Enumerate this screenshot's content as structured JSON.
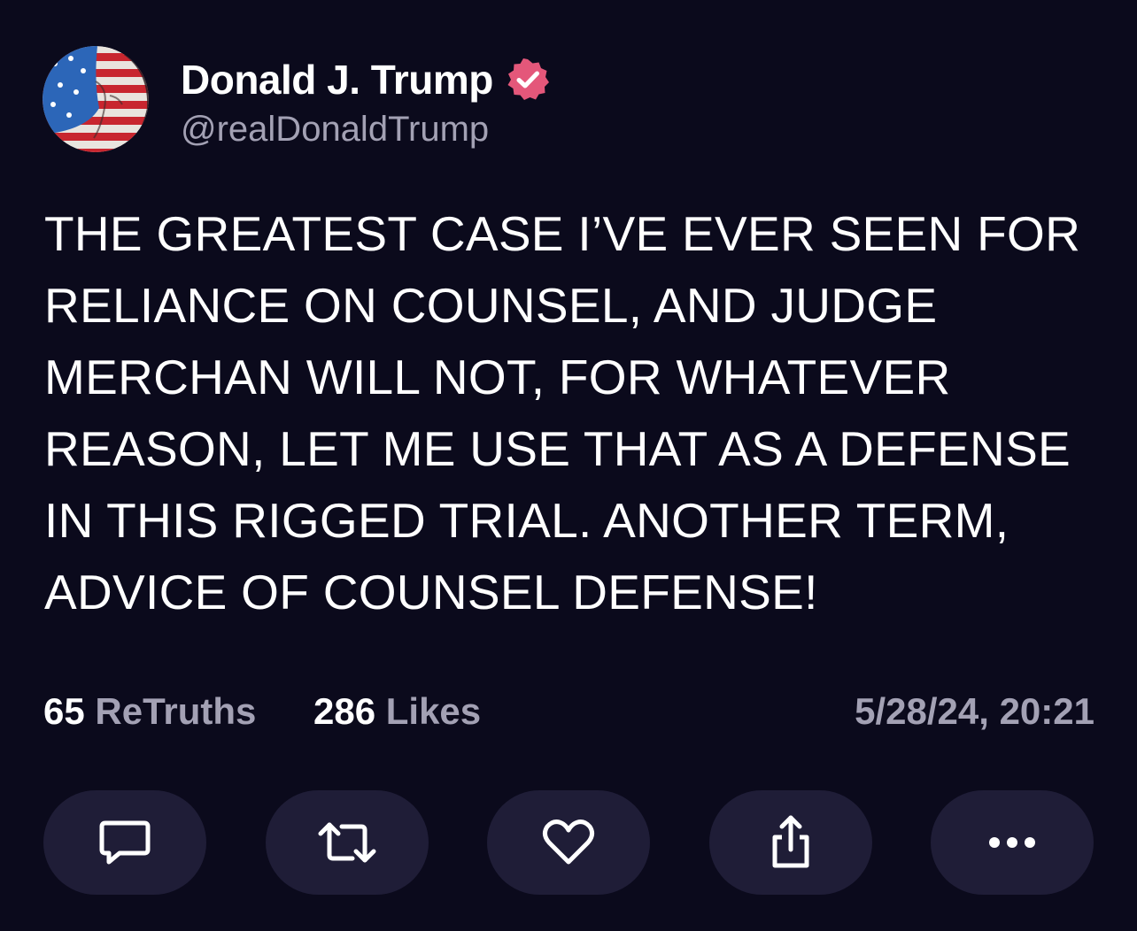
{
  "post": {
    "author": {
      "display_name": "Donald J. Trump",
      "handle": "@realDonaldTrump",
      "verified": true,
      "verified_color": "#e4577a"
    },
    "body_lines": [
      "THE GREATEST CASE I’VE EVER SEEN FOR",
      "RELIANCE ON COUNSEL, AND JUDGE",
      "MERCHAN WILL NOT, FOR WHATEVER",
      "REASON, LET ME USE THAT AS A DEFENSE",
      "IN THIS RIGGED TRIAL. ANOTHER TERM,",
      "ADVICE OF COUNSEL DEFENSE!"
    ],
    "stats": {
      "retruths_count": "65",
      "retruths_label": "ReTruths",
      "likes_count": "286",
      "likes_label": "Likes",
      "timestamp": "5/28/24, 20:21"
    },
    "actions": [
      {
        "name": "reply",
        "icon": "comment-icon"
      },
      {
        "name": "retruth",
        "icon": "repost-icon"
      },
      {
        "name": "like",
        "icon": "heart-icon"
      },
      {
        "name": "share",
        "icon": "share-icon"
      },
      {
        "name": "more",
        "icon": "more-icon"
      }
    ]
  },
  "colors": {
    "background": "#0b0a1c",
    "button_bg": "#1f1d37",
    "secondary_text": "#a3a1b4",
    "primary_text": "#ffffff"
  }
}
